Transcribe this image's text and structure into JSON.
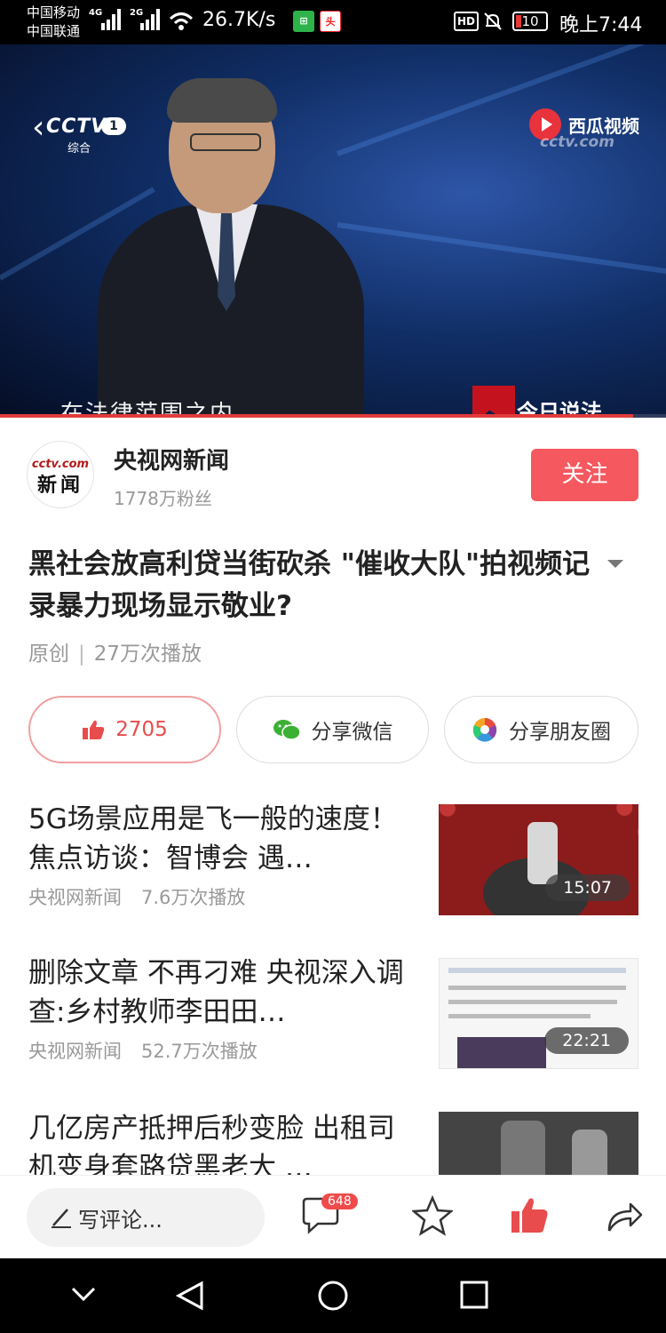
{
  "status_bar": {
    "carrier_1": "中国移动",
    "carrier_2": "中国联通",
    "sig_1_label": "4G",
    "sig_2_label": "2G",
    "net_speed": "26.7K/s",
    "hd_label": "HD",
    "battery": "10",
    "time": "晚上7:44"
  },
  "video": {
    "channel_logo": "CCTV",
    "channel_number": "1",
    "channel_sub": "综合",
    "watermark_brand": "西瓜视频",
    "watermark_url": "cctv.com",
    "subtitle": "在法律范围之内",
    "program_name": "今日说法",
    "progress_fraction": 0.95
  },
  "author": {
    "avatar_line1": "cctv.com",
    "avatar_line2": "新闻",
    "name": "央视网新闻",
    "fans": "1778万粉丝",
    "follow_label": "关注"
  },
  "article": {
    "title": "黑社会放高利贷当街砍杀 \"催收大队\"拍视频记录暴力现场显示敬业?",
    "source": "原创",
    "separator": "|",
    "plays": "27万次播放"
  },
  "actions": {
    "like_count": "2705",
    "share_wechat": "分享微信",
    "share_moments": "分享朋友圈"
  },
  "related": [
    {
      "title": "5G场景应用是飞一般的速度！焦点访谈：智博会 遇…",
      "author": "央视网新闻",
      "plays": "7.6万次播放",
      "duration": "15:07"
    },
    {
      "title": "删除文章 不再刁难 央视深入调查:乡村教师李田田…",
      "author": "央视网新闻",
      "plays": "52.7万次播放",
      "duration": "22:21"
    },
    {
      "title": "几亿房产抵押后秒变脸 出租司机变身套路贷黑老大 …",
      "author": "",
      "plays": "",
      "duration": ""
    }
  ],
  "bottom_bar": {
    "comment_placeholder": "写评论...",
    "comment_count": "648"
  },
  "colors": {
    "accent": "#f5585e",
    "like": "#e84c4c",
    "badge": "#f04b4b"
  }
}
